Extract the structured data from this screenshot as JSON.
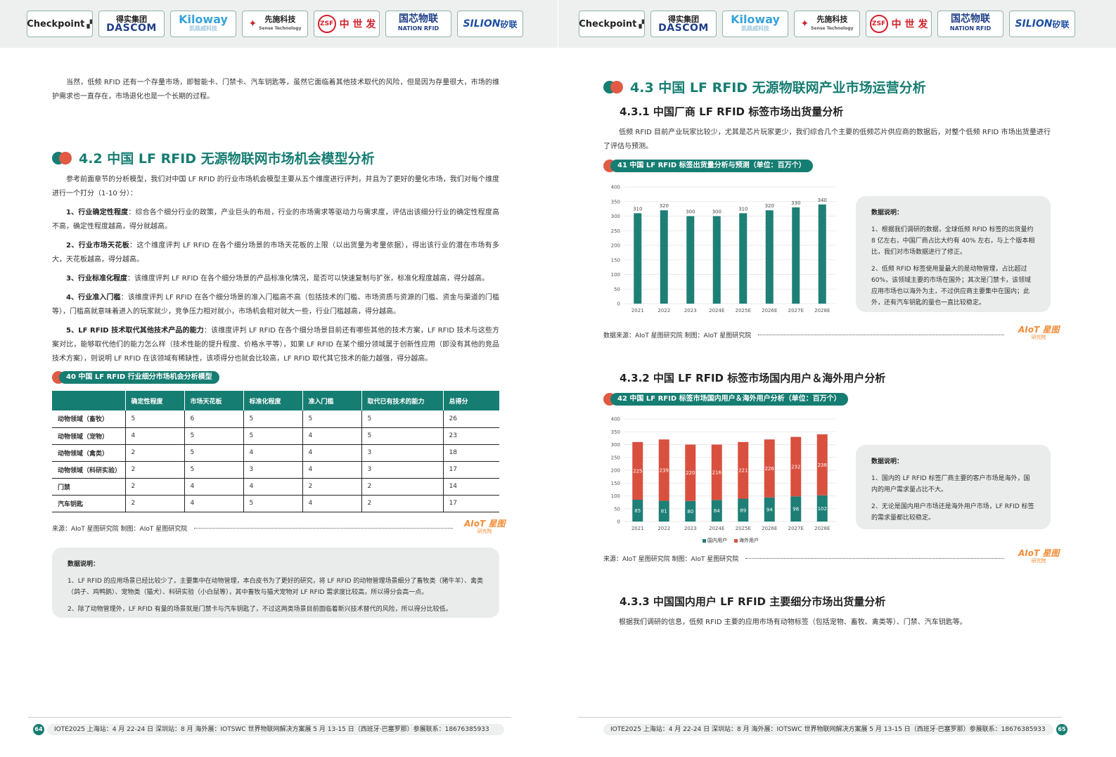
{
  "logos": [
    "Checkpoint",
    "得实集团",
    "DASCOM",
    "Kiloway",
    "凯路威科技",
    "先施科技",
    "Sense Technology",
    "ZSF",
    "中 世 发",
    "国芯物联",
    "NATION RFID",
    "SILION",
    "矽联"
  ],
  "left": {
    "intro": "当然，低频 RFID 还有一个存量市场，即智能卡、门禁卡、汽车钥匙等，虽然它面临着其他技术取代的风险，但是因为存量很大，市场的维护需求也一直存在，市场退化也是一个长期的过程。",
    "h2": "4.2  中国 LF RFID 无源物联网市场机会模型分析",
    "p1": "参考前面章节的分析模型，我们对中国 LF RFID 的行业市场机会模型主要从五个维度进行评判，并且为了更好的量化市场，我们对每个维度进行一个打分（1-10 分）：",
    "d1_title": "1、行业确定性程度",
    "d1_text": "：综合各个细分行业的政策，产业巨头的布局，行业的市场需求等驱动力与需求度，评估出该细分行业的确定性程度高不高，确定性程度越高，得分就越高。",
    "d2_title": "2、行业市场天花板",
    "d2_text": "：这个维度评判 LF RFID 在各个细分场景的市场天花板的上限（以出货量为考量依据），得出该行业的潜在市场有多大，天花板越高，得分越高。",
    "d3_title": "3、行业标准化程度",
    "d3_text": "：该维度评判 LF RFID 在各个细分场景的产品标准化情况，是否可以快速复制与扩张，标准化程度越高，得分越高。",
    "d4_title": "4、行业准入门槛",
    "d4_text": "：该维度评判 LF RFID 在各个细分场景的准入门槛高不高（包括技术的门槛、市场资质与资源的门槛、资金与渠道的门槛等），门槛高就意味着进入的玩家就少，竞争压力相对就小，市场机会相对就大一些，行业门槛越高，得分越高。",
    "d5_title": "5、LF RFID 技术取代其他技术产品的能力",
    "d5_text": "：该维度评判 LF RFID 在各个细分场景目前还有哪些其他的技术方案，LF RFID 技术与这些方案对比，能够取代他们的能力怎么样（技术性能的提升程度、价格水平等），如果 LF RFID 在某个细分领域属于创新性应用（即没有其他的竞品技术方案），则说明 LF RFID 在该领域有稀缺性，该项得分也就会比较高，LF RFID 取代其它技术的能力越强，得分越高。",
    "fig_label": "40 中国 LF RFID 行业细分市场机会分析模型",
    "table": {
      "headers": [
        "",
        "确定性程度",
        "市场天花板",
        "标准化程度",
        "准入门槛",
        "取代已有技术的能力",
        "总得分"
      ],
      "rows": [
        [
          "动物领域（畜牧）",
          "5",
          "6",
          "5",
          "5",
          "5",
          "26"
        ],
        [
          "动物领域（宠物）",
          "4",
          "5",
          "5",
          "4",
          "5",
          "23"
        ],
        [
          "动物领域（禽类）",
          "2",
          "5",
          "4",
          "4",
          "3",
          "18"
        ],
        [
          "动物领域（科研实验）",
          "2",
          "5",
          "3",
          "4",
          "3",
          "17"
        ],
        [
          "门禁",
          "2",
          "4",
          "4",
          "2",
          "2",
          "14"
        ],
        [
          "汽车钥匙",
          "2",
          "4",
          "5",
          "4",
          "2",
          "17"
        ]
      ]
    },
    "source": "来源：AIoT 星图研究院    制图：AIoT 星图研究院",
    "note_title": "数据说明：",
    "note1": "1、LF RFID 的应用场景已经比较少了，主要集中在动物管理，本白皮书为了更好的研究，将 LF RFID 的动物管理场景细分了畜牧类（猪牛羊）、禽类（鸽子、鸡鸭鹅）、宠物类（猫犬）、科研实验（小白鼠等），其中畜牧与猫犬宠物对 LF RFID 需求度比较高，所以得分会高一点。",
    "note2": "2、除了动物管理外，LF RFID 有量的场景就是门禁卡与汽车钥匙了，不过这两类场景目前面临着新兴技术替代的风险，所以得分比较低。",
    "page_no": "64",
    "footer": "IOTE2025  上海站：4 月 22-24 日  深圳站：8 月  海外展：IOTSWC 世界物联网解决方案展  5 月 13-15 日（西班牙·巴塞罗那）参展联系：18676385933"
  },
  "right": {
    "h2": "4.3 中国 LF RFID 无源物联网产业市场运营分析",
    "h3_1": "4.3.1 中国厂商 LF RFID 标签市场出货量分析",
    "p1": "低频 RFID 目前产业玩家比较少，尤其是芯片玩家更少，我们综合几个主要的低频芯片供应商的数据后，对整个低频 RFID 市场出货量进行了评估与预测。",
    "fig41_label": "41 中国 LF RFID 标签出货量分析与预测（单位：百万个）",
    "note41_title": "数据说明：",
    "note41_1": "1、根据我们调研的数据，全球低频 RFID 标签的出货量约 8 亿左右，中国厂商占比大约有 40% 左右，与上个版本相比，我们对市场数据进行了修正。",
    "note41_2": "2、低频 RFID 标签使用量最大的是动物管理，占比超过 60%，该领域主要的市场在国外；其次是门禁卡，该领域应用市场也以海外为主，不过供应商主要集中在国内；此外，还有汽车钥匙的量也一直比较稳定。",
    "source41": "数据来源：AIoT 星图研究院    制图：AIoT 星图研究院",
    "h3_2": "4.3.2 中国 LF RFID 标签市场国内用户＆海外用户分析",
    "fig42_label": "42 中国 LF RFID 标签市场国内用户＆海外用户分析（单位：百万个）",
    "note42_title": "数据说明：",
    "note42_1": "1、国内的 LF RFID 标签厂商主要的客户市场是海外，国内的用户需求量占比不大。",
    "note42_2": "2、无论是国内用户市场还是海外用户市场，LF RFID 标签的需求量都比较稳定。",
    "source42": "来源：AIoT 星图研究院    制图：AIoT 星图研究院",
    "h3_3": "4.3.3 中国国内用户 LF RFID 主要细分市场出货量分析",
    "p3": "根据我们调研的信息，低频 RFID 主要的应用市场有动物标签（包括宠物、畜牧、禽类等）、门禁、汽车钥匙等。",
    "page_no": "65",
    "footer": "IOTE2025  上海站：4 月 22-24 日  深圳站：8 月  海外展：IOTSWC 世界物联网解决方案展  5 月 13-15 日（西班牙·巴塞罗那）参展联系：18676385933"
  },
  "aiot_logo": "AIoT 星图",
  "aiot_sub": "研究院",
  "colors": {
    "teal": "#167d72",
    "red": "#e05a44",
    "bar": "#1e7f76"
  },
  "chart_data": [
    {
      "type": "bar",
      "title": "41 中国 LF RFID 标签出货量分析与预测（单位：百万个）",
      "categories": [
        "2021",
        "2022",
        "2023",
        "2024E",
        "2025E",
        "2026E",
        "2027E",
        "2028E"
      ],
      "values": [
        310,
        320,
        300,
        300,
        310,
        320,
        330,
        340
      ],
      "ylim": [
        0,
        400
      ],
      "yticks": [
        0,
        50,
        100,
        150,
        200,
        250,
        300,
        350,
        400
      ],
      "grid": true
    },
    {
      "type": "bar",
      "stacked": true,
      "title": "42 中国 LF RFID 标签市场国内用户＆海外用户分析（单位：百万个）",
      "categories": [
        "2021",
        "2022",
        "2023",
        "2024E",
        "2025E",
        "2026E",
        "2027E",
        "2028E"
      ],
      "series": [
        {
          "name": "国内用户",
          "values": [
            85,
            81,
            80,
            84,
            89,
            94,
            98,
            102
          ],
          "color": "#1e7f76"
        },
        {
          "name": "海外用户",
          "values": [
            225,
            239,
            220,
            216,
            221,
            226,
            232,
            238
          ],
          "color": "#d9503f"
        }
      ],
      "ylim": [
        0,
        400
      ],
      "yticks": [
        0,
        50,
        100,
        150,
        200,
        250,
        300,
        350,
        400
      ],
      "legend": "bottom",
      "grid": true
    }
  ]
}
